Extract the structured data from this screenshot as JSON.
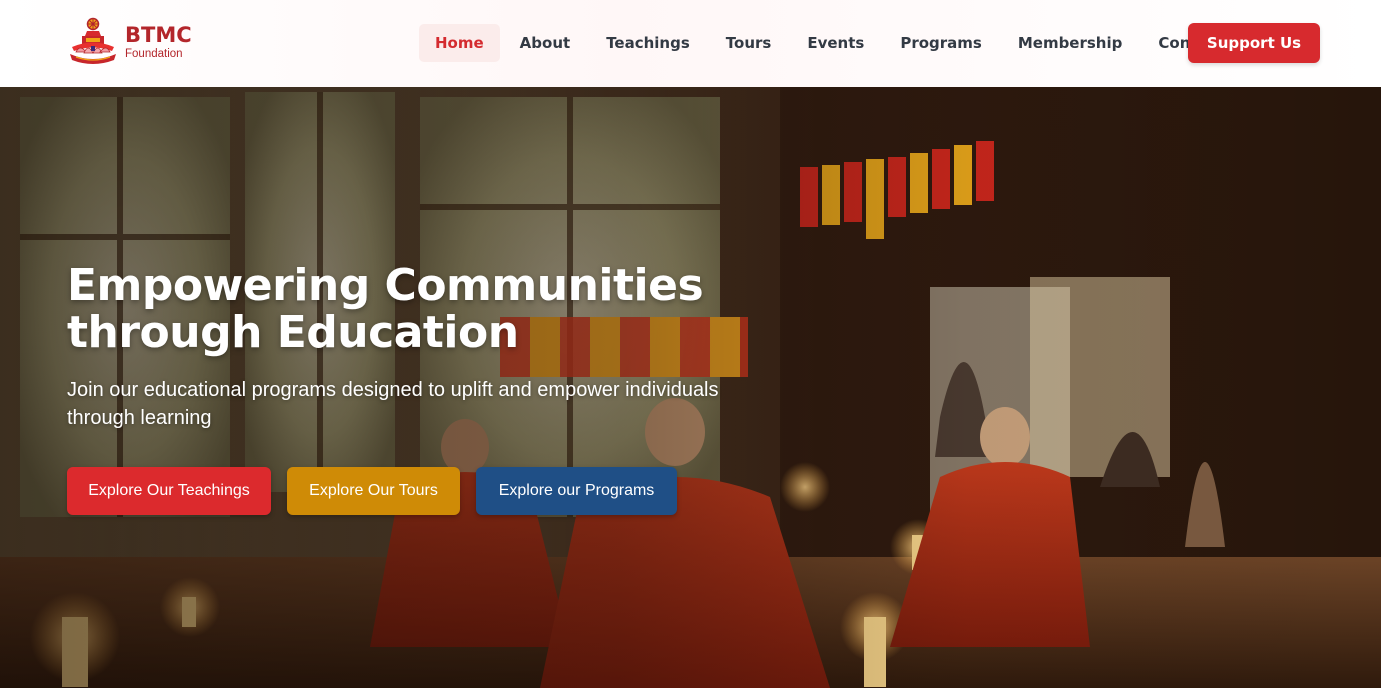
{
  "brand": {
    "title": "BTMC",
    "subtitle": "Foundation",
    "primary_color": "#d72a2e",
    "logo_icon": "temple-lotus-emblem-icon"
  },
  "nav": {
    "items": [
      {
        "label": "Home",
        "active": true
      },
      {
        "label": "About"
      },
      {
        "label": "Teachings"
      },
      {
        "label": "Tours"
      },
      {
        "label": "Events"
      },
      {
        "label": "Programs"
      },
      {
        "label": "Membership"
      },
      {
        "label": "Contact"
      }
    ],
    "cta_label": "Support Us"
  },
  "hero": {
    "title_line1": "Empowering Communities",
    "title_line2": "through Education",
    "subtitle": "Join our educational programs designed to uplift and empower individuals through learning",
    "background": "monks-meditating-in-temple-image",
    "buttons": [
      {
        "label": "Explore Our Teachings",
        "color": "#dc2a2d"
      },
      {
        "label": "Explore Our Tours",
        "color": "#cf8b06"
      },
      {
        "label": "Explore our Programs",
        "color": "#1f4f86"
      }
    ]
  }
}
